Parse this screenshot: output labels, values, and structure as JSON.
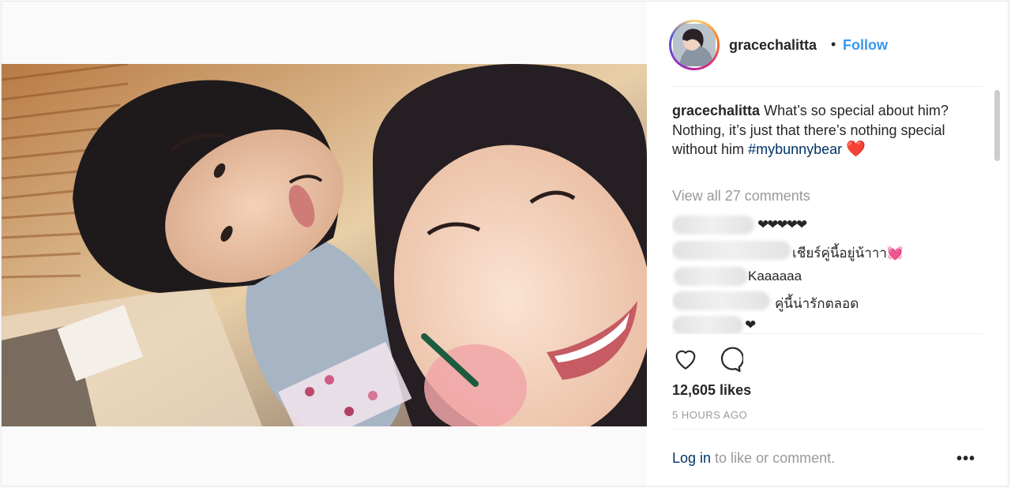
{
  "post": {
    "username": "gracechalitta",
    "header_separator": "•",
    "follow_label": "Follow",
    "caption": {
      "username": "gracechalitta",
      "text": "What’s so special about him? Nothing, it’s just that there’s nothing special without him",
      "hashtag": "#mybunnybear",
      "emoji": "❤️"
    },
    "view_all_comments": "View all 27 comments",
    "comments": [
      {
        "text": "❤❤❤❤❤"
      },
      {
        "text": "เชียร์คู่นี้อยู่น้าาา💓"
      },
      {
        "text": "Kaaaaaa"
      },
      {
        "text": "คู่นี้น่ารักตลอด"
      },
      {
        "text": "❤"
      }
    ],
    "likes": "12,605 likes",
    "time_ago": "5 HOURS AGO",
    "login_link": "Log in",
    "login_suffix": " to like or comment.",
    "more_label": "•••",
    "icons": {
      "like": "heart-icon",
      "comment": "comment-bubble-icon",
      "more": "more-options-icon"
    },
    "colors": {
      "follow": "#3897f0",
      "hashtag": "#003569",
      "muted": "#999999"
    }
  }
}
